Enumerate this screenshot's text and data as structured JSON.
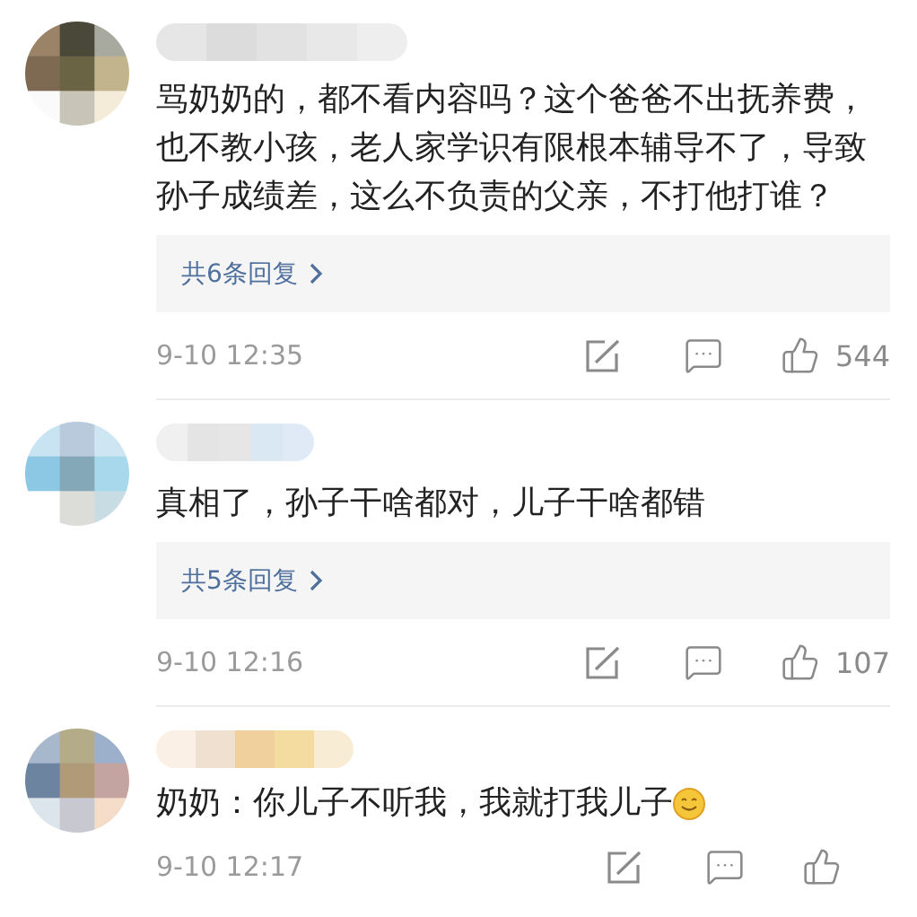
{
  "comments": [
    {
      "text": "骂奶奶的，都不看内容吗？这个爸爸不出抚养费，也不教小孩，老人家学识有限根本辅导不了，导致孙子成绩差，这么不负责的父亲，不打他打谁？",
      "replies": "共6条回复",
      "has_emoji": false,
      "time": "9-10 12:35",
      "likes": "544"
    },
    {
      "text": "真相了，孙子干啥都对，儿子干啥都错",
      "replies": "共5条回复",
      "has_emoji": false,
      "time": "9-10 12:16",
      "likes": "107"
    },
    {
      "text": "奶奶：你儿子不听我，我就打我儿子",
      "has_emoji": true,
      "time": "9-10 12:17"
    }
  ]
}
